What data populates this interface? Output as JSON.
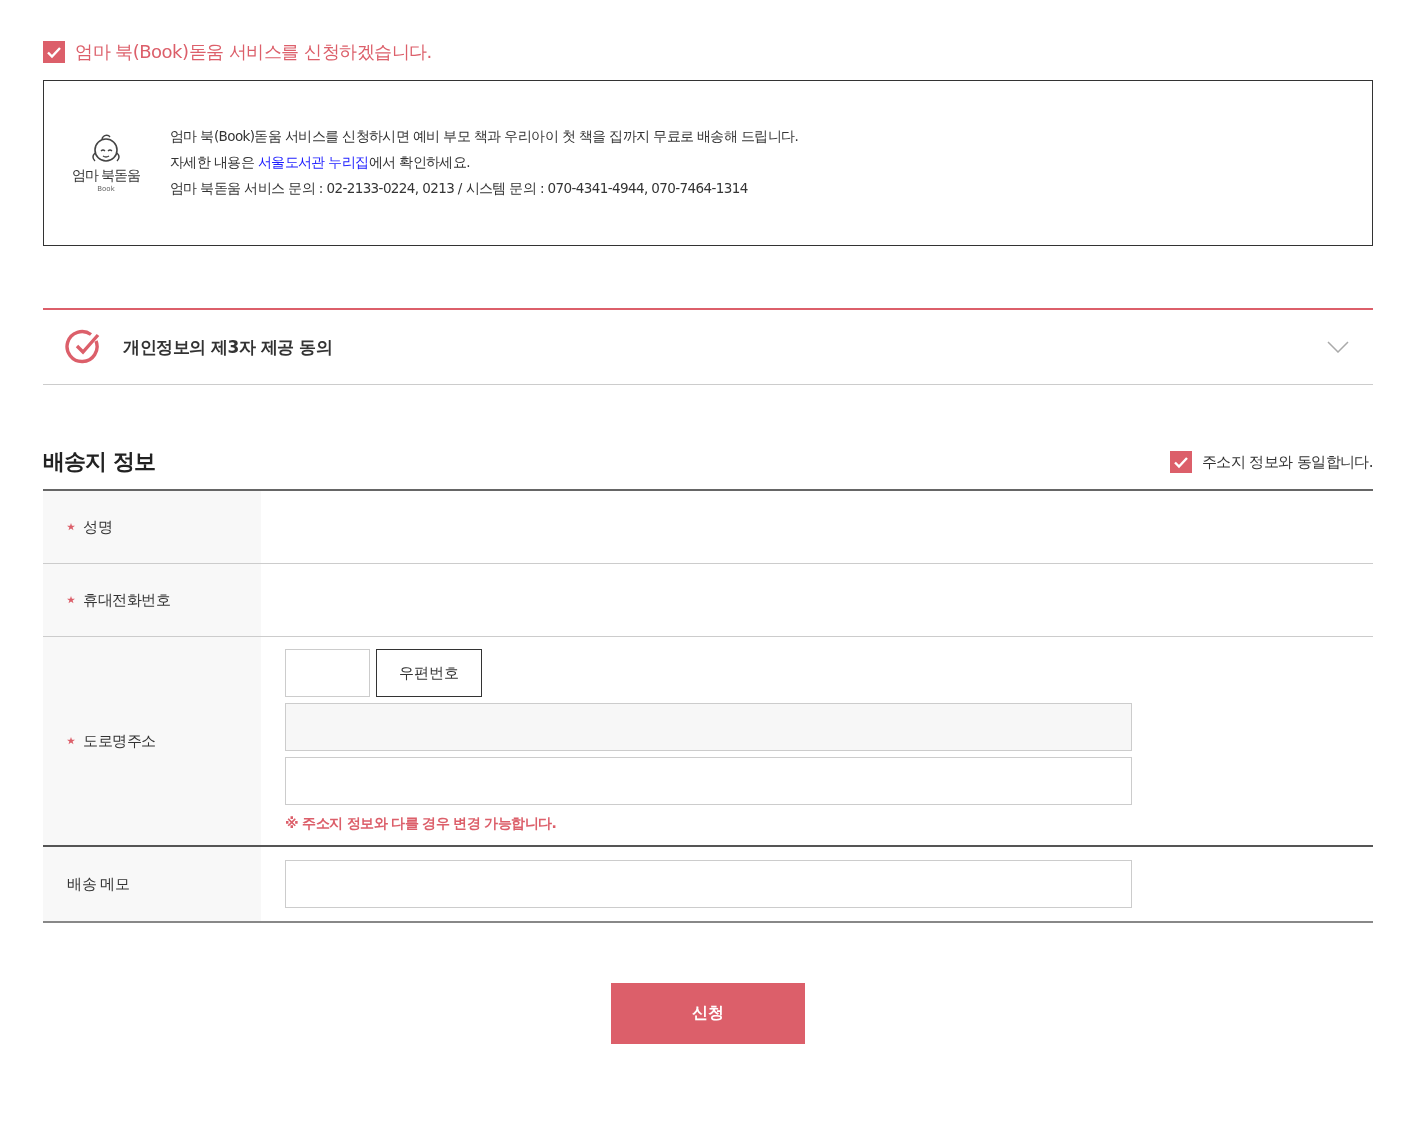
{
  "apply_consent": {
    "checked": true,
    "label": "엄마 북(Book)돋움 서비스를 신청하겠습니다."
  },
  "info_box": {
    "logo_title": "엄마 북돋움",
    "logo_subtitle": "Book",
    "line_1": "엄마 북(Book)돋움 서비스를 신청하시면 예비 부모 책과 우리아이 첫 책을 집까지 무료로 배송해 드립니다.",
    "line_2_before": "자세한 내용은 ",
    "line_2_link": "서울도서관 누리집",
    "line_2_after": "에서 확인하세요.",
    "line_3": "엄마 북돋움 서비스 문의 : 02-2133-0224, 0213 / 시스템 문의 : 070-4341-4944, 070-7464-1314"
  },
  "accordion": {
    "title": "개인정보의 제3자 제공 동의",
    "expanded": false
  },
  "shipping": {
    "title": "배송지 정보",
    "same_as_address": {
      "checked": true,
      "label": "주소지 정보와 동일합니다."
    },
    "rows": [
      {
        "kind": "empty",
        "label": "성명",
        "required": true
      },
      {
        "kind": "empty",
        "label": "휴대전화번호",
        "required": true
      },
      {
        "kind": "address",
        "label": "도로명주소",
        "required": true,
        "postcode_button": "우편번호",
        "note": "※ 주소지 정보와 다를 경우 변경 가능합니다."
      },
      {
        "kind": "memo",
        "label": "배송 메모",
        "required": false
      }
    ]
  },
  "submit_button": "신청"
}
